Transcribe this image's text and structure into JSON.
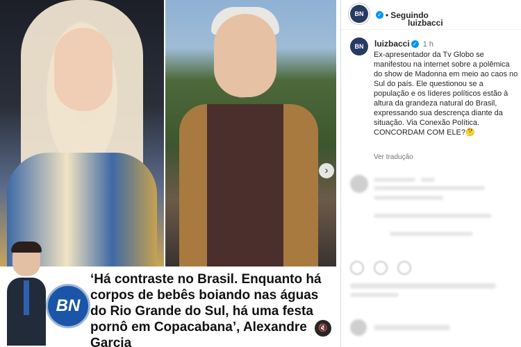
{
  "post": {
    "caption_quote": "‘Há contraste no Brasil.  Enquanto há corpos de bebês boiando nas águas do Rio Grande do Sul, há uma festa pornô em Copacabana’, Alexandre Garcia",
    "logo_text": "BN",
    "next_icon": "chevron-right-icon",
    "sound_icon": "speaker-muted-icon"
  },
  "header": {
    "username": "luizbacci",
    "separator": "•",
    "follow_status": "Seguindo"
  },
  "caption": {
    "username": "luizbacci",
    "time": "1 h",
    "text": "Ex-apresentador da Tv Globo se manifestou na internet sobre a polêmica do show de Madonna em meio ao caos no Sul do país. Ele questionou se a população e os líderes políticos estão à altura da grandeza natural do Brasil, expressando sua descrença diante da situação. Via Conexão Política. CONCORDAM COM ELE?🤔",
    "translate_label": "Ver tradução"
  },
  "colors": {
    "verified": "#0095f6",
    "logo_blue": "#1a55a8",
    "border": "#dbdbdb"
  }
}
